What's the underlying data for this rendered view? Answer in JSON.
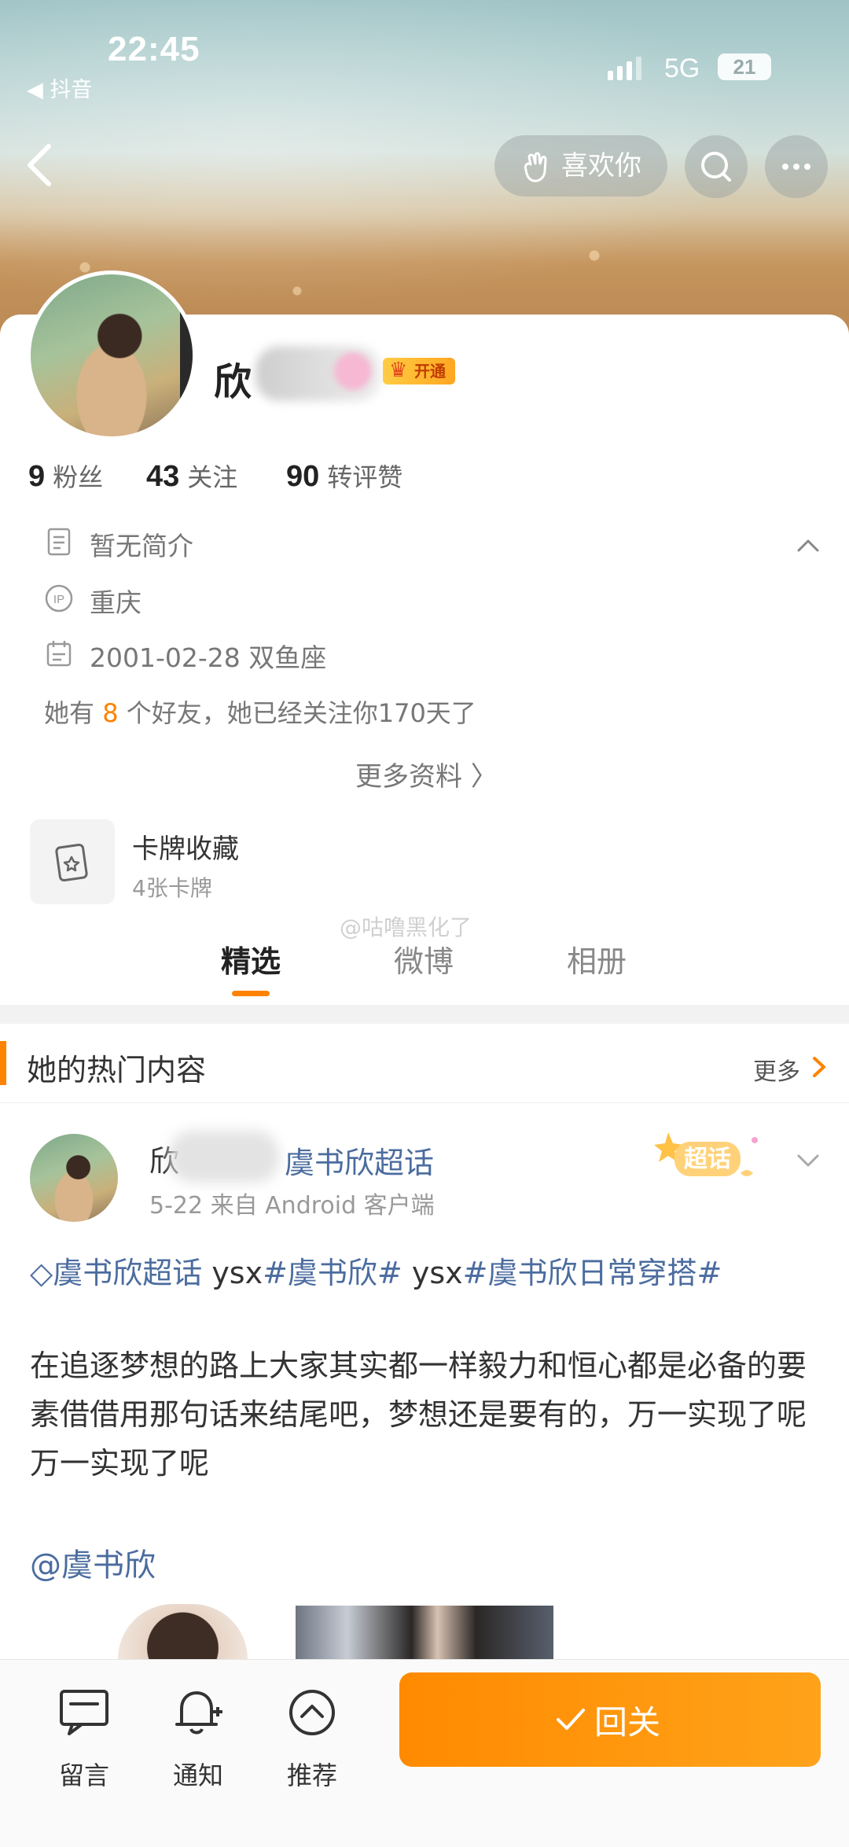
{
  "status_bar": {
    "time": "22:45",
    "back_app": "◀ 抖音",
    "network": "5G",
    "battery": "21"
  },
  "top_nav": {
    "like_label": "喜欢你"
  },
  "profile": {
    "name_visible": "欣",
    "vip_badge": "开通",
    "stats": [
      {
        "value": "9",
        "label": "粉丝"
      },
      {
        "value": "43",
        "label": "关注"
      },
      {
        "value": "90",
        "label": "转评赞"
      }
    ],
    "bio": "暂无简介",
    "ip_location": "重庆",
    "birthday": "2001-02-28 双鱼座",
    "friends_prefix": "她有",
    "friends_count": "8",
    "friends_suffix": "个好友，她已经关注你170天了",
    "more_info": "更多资料 〉",
    "cards_title": "卡牌收藏",
    "cards_sub": "4张卡牌",
    "watermark": "@咕噜黑化了"
  },
  "tabs": [
    "精选",
    "微博",
    "相册"
  ],
  "hot": {
    "title": "她的热门内容",
    "more": "更多"
  },
  "post": {
    "author_visible": "欣",
    "topic": "虞书欣超话",
    "meta": "5-22  来自 Android 客户端",
    "supertopic_badge": "超话",
    "tags": [
      {
        "text": "◇虞书欣超话",
        "kind": "link"
      },
      {
        "text": " ysx",
        "kind": "plain"
      },
      {
        "text": "#虞书欣#",
        "kind": "link"
      },
      {
        "text": " ysx",
        "kind": "plain"
      },
      {
        "text": "#虞书欣日常穿搭#",
        "kind": "link"
      }
    ],
    "body": "在追逐梦想的路上大家其实都一样毅力和恒心都是必备的要素借借用那句话来结尾吧，梦想还是要有的，万一实现了呢万一实现了呢",
    "mention": "@虞书欣"
  },
  "bottom_bar": {
    "items": [
      "留言",
      "通知",
      "推荐"
    ],
    "follow_label": "回关"
  },
  "colors": {
    "accent": "#ff8200",
    "link": "#4b6c9f"
  }
}
